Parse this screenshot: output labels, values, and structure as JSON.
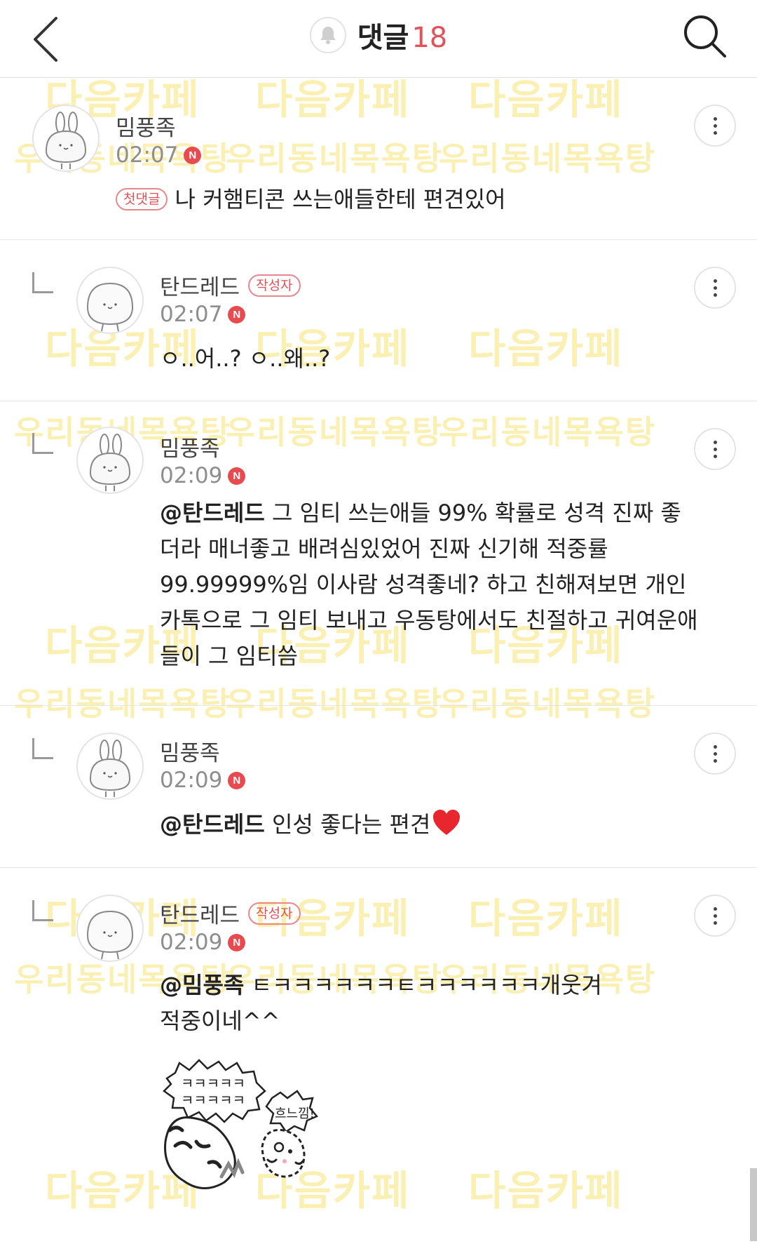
{
  "header": {
    "back_icon": "chevron-left-icon",
    "title": "댓글",
    "count": "18",
    "bell_icon": "bell-icon",
    "search_icon": "search-icon"
  },
  "watermark": {
    "primary": "다음카페",
    "secondary": "우리동네목욕탕"
  },
  "comments": [
    {
      "nickname": "밈풍족",
      "time": "02:07",
      "new_badge": "N",
      "first_badge": "첫댓글",
      "mention": "",
      "text": "나 커햄티콘 쓰는애들한테 편견있어"
    },
    {
      "nickname": "탄드레드",
      "author_badge": "작성자",
      "time": "02:07",
      "new_badge": "N",
      "mention": "",
      "text": "ㅇ..어..? ㅇ..왜..?"
    },
    {
      "nickname": "밈풍족",
      "time": "02:09",
      "new_badge": "N",
      "mention": "@탄드레드",
      "text": " 그 임티 쓰는애들 99% 확률로 성격 진짜 좋더라 매너좋고 배려심있었어 진짜 신기해 적중률 99.99999%임 이사람 성격좋네? 하고 친해져보면 개인카톡으로 그 임티 보내고 우동탕에서도 친절하고 귀여운애들이 그 임티씀"
    },
    {
      "nickname": "밈풍족",
      "time": "02:09",
      "new_badge": "N",
      "mention": "@탄드레드",
      "text": " 인성 좋다는 편견"
    },
    {
      "nickname": "탄드레드",
      "author_badge": "작성자",
      "time": "02:09",
      "new_badge": "N",
      "mention": "@밈풍족",
      "text": " ㅌㅋㅋㅋㅋㅋㅋㅌㅋㅋㅋㅋㅋㅋ개웃겨 적중이네^^",
      "sticker_text_1": "ㅋㅋㅋㅋㅋ",
      "sticker_text_2": "ㅋㅋㅋㅋㅋ",
      "sticker_text_3": "흐느낌!"
    }
  ],
  "colors": {
    "accent": "#e2525a",
    "new_badge": "#e84a4f",
    "watermark": "#fbf0b4"
  }
}
